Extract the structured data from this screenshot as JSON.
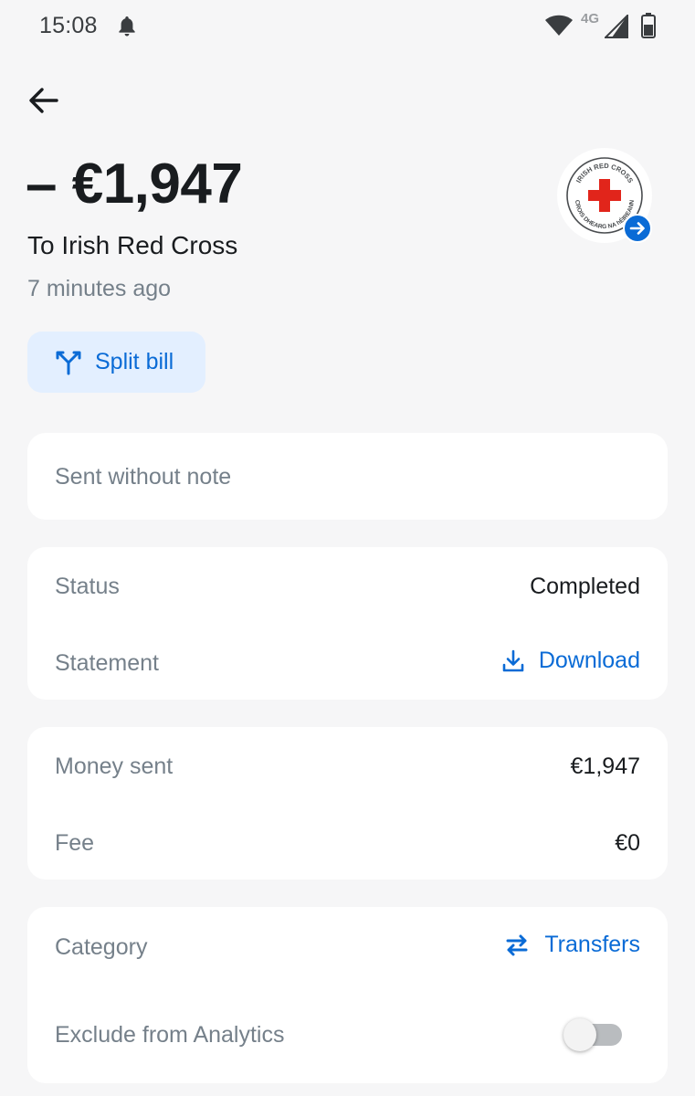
{
  "status_bar": {
    "time": "15:08",
    "network": "4G"
  },
  "transaction": {
    "amount": "– €1,947",
    "recipient": "To Irish Red Cross",
    "time_ago": "7 minutes ago",
    "logo_text_top": "IRISH RED CROSS",
    "logo_text_bottom": "CROIS DHEARG NA hÉIREANN"
  },
  "actions": {
    "split_bill": "Split bill"
  },
  "note_card": {
    "text": "Sent without note"
  },
  "status_card": {
    "status_label": "Status",
    "status_value": "Completed",
    "statement_label": "Statement",
    "statement_action": "Download"
  },
  "money_card": {
    "sent_label": "Money sent",
    "sent_value": "€1,947",
    "fee_label": "Fee",
    "fee_value": "€0"
  },
  "category_card": {
    "category_label": "Category",
    "category_value": "Transfers",
    "exclude_label": "Exclude from Analytics",
    "exclude_enabled": false
  },
  "colors": {
    "accent": "#0a6bd6",
    "accent_bg": "#e3efff",
    "background": "#f6f6f7",
    "muted_text": "#75808a",
    "red_cross": "#e1251b"
  },
  "icons": {
    "back": "arrow-left-icon",
    "split": "split-icon",
    "download": "download-icon",
    "transfers": "transfer-arrows-icon",
    "badge": "arrow-right-circle-icon"
  }
}
